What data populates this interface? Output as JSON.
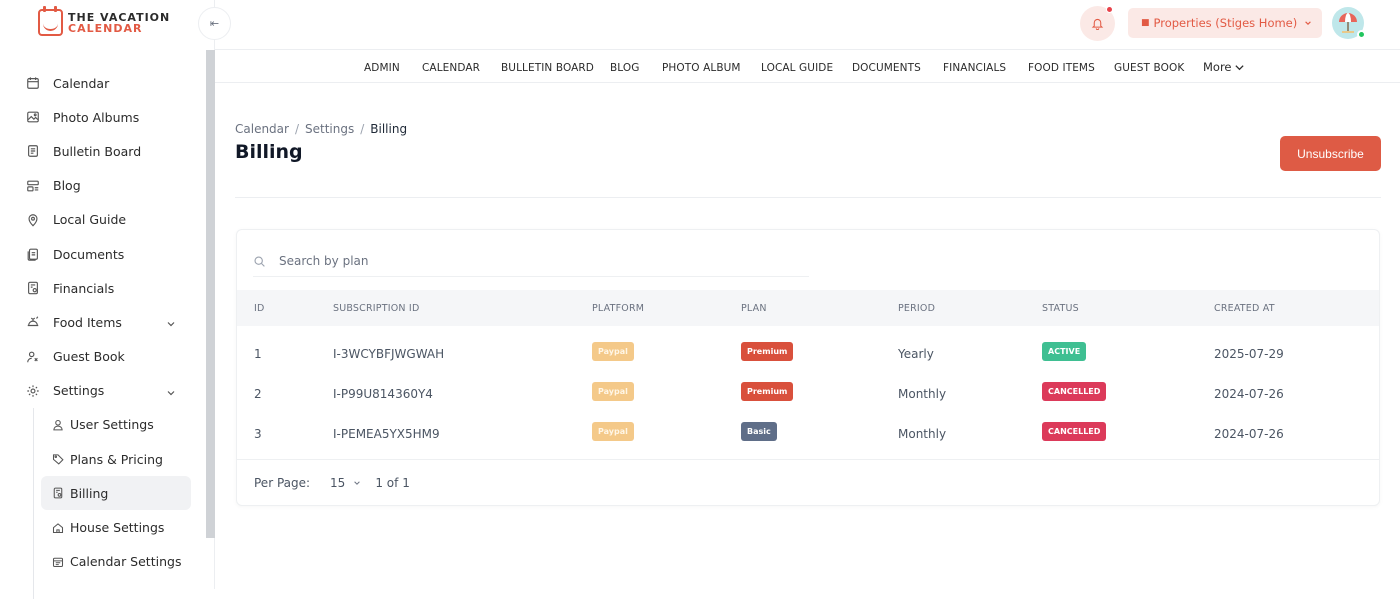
{
  "brand": {
    "line1": "THE VACATION",
    "line2": "CALENDAR"
  },
  "sidebar": {
    "items": [
      {
        "label": "Calendar"
      },
      {
        "label": "Photo Albums"
      },
      {
        "label": "Bulletin Board"
      },
      {
        "label": "Blog"
      },
      {
        "label": "Local Guide"
      },
      {
        "label": "Documents"
      },
      {
        "label": "Financials"
      },
      {
        "label": "Food Items"
      },
      {
        "label": "Guest Book"
      },
      {
        "label": "Settings"
      }
    ],
    "settings_sub": [
      {
        "label": "User Settings"
      },
      {
        "label": "Plans & Pricing"
      },
      {
        "label": "Billing"
      },
      {
        "label": "House Settings"
      },
      {
        "label": "Calendar Settings"
      }
    ]
  },
  "topbar": {
    "property_select": "Properties (Stiges Home)"
  },
  "menu": {
    "items": [
      "ADMIN",
      "CALENDAR",
      "BULLETIN BOARD",
      "BLOG",
      "PHOTO ALBUM",
      "LOCAL GUIDE",
      "DOCUMENTS",
      "FINANCIALS",
      "FOOD ITEMS",
      "GUEST BOOK"
    ],
    "more": "More"
  },
  "breadcrumb": [
    "Calendar",
    "Settings",
    "Billing"
  ],
  "page": {
    "title": "Billing",
    "unsubscribe_label": "Unsubscribe"
  },
  "search": {
    "placeholder": "Search by plan"
  },
  "table": {
    "headers": [
      "ID",
      "SUBSCRIPTION ID",
      "PLATFORM",
      "PLAN",
      "PERIOD",
      "STATUS",
      "CREATED AT"
    ],
    "rows": [
      {
        "id": "1",
        "subscription_id": "I-3WCYBFJWGWAH",
        "platform": "Paypal",
        "plan": "Premium",
        "period": "Yearly",
        "status": "ACTIVE",
        "created_at": "2025-07-29"
      },
      {
        "id": "2",
        "subscription_id": "I-P99U814360Y4",
        "platform": "Paypal",
        "plan": "Premium",
        "period": "Monthly",
        "status": "CANCELLED",
        "created_at": "2024-07-26"
      },
      {
        "id": "3",
        "subscription_id": "I-PEMEA5YX5HM9",
        "platform": "Paypal",
        "plan": "Basic",
        "period": "Monthly",
        "status": "CANCELLED",
        "created_at": "2024-07-26"
      }
    ]
  },
  "pagination": {
    "per_page_label": "Per Page:",
    "per_page_value": "15",
    "page_current": "1",
    "page_of": "of",
    "page_total": "1"
  },
  "colors": {
    "accent": "#de5b45",
    "active": "#3fbf92",
    "cancelled": "#dc3a5a",
    "paypal": "#f4c989",
    "basic": "#5f6e88"
  }
}
